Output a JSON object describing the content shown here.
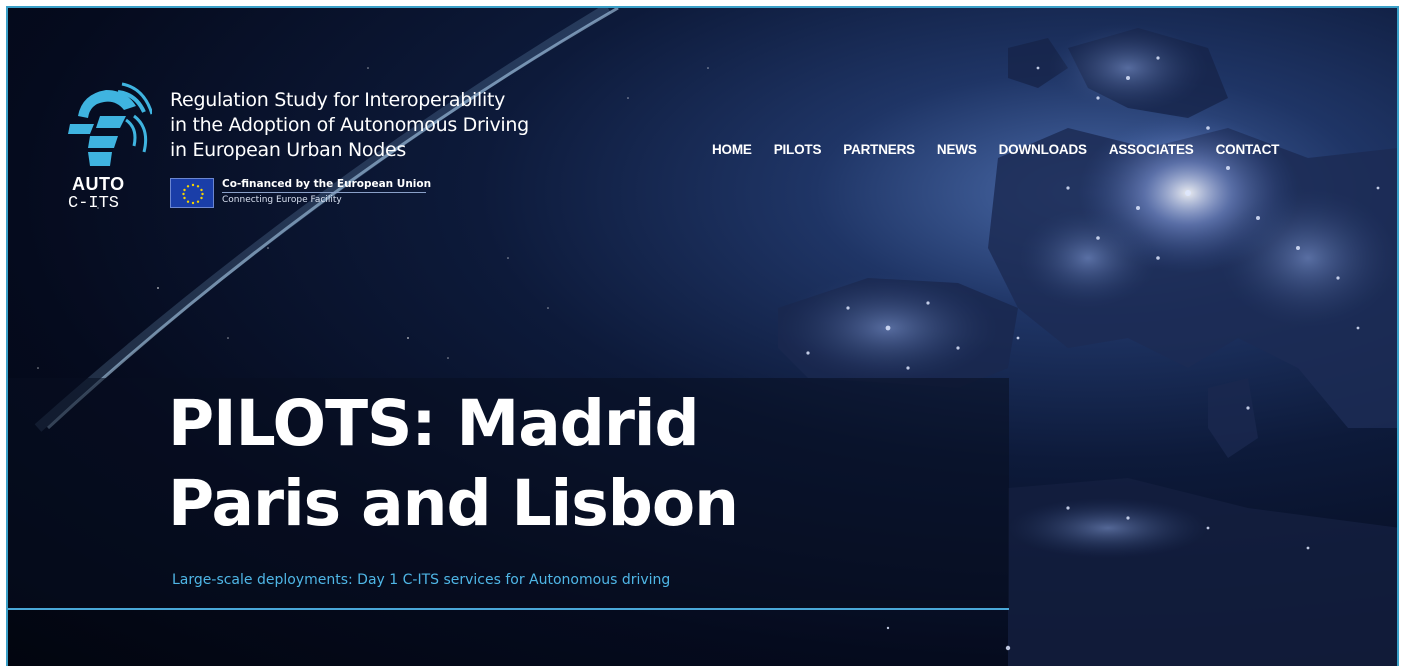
{
  "logo": {
    "name_line1": "AUTO",
    "name_line2": "C-ITS"
  },
  "tagline": {
    "line1": "Regulation Study for Interoperability",
    "line2": "in the Adoption of Autonomous Driving",
    "line3": "in European Urban Nodes"
  },
  "funding": {
    "line1": "Co-financed by the European Union",
    "line2": "Connecting Europe Facility"
  },
  "nav": {
    "items": [
      {
        "label": "HOME"
      },
      {
        "label": "PILOTS"
      },
      {
        "label": "PARTNERS"
      },
      {
        "label": "NEWS"
      },
      {
        "label": "DOWNLOADS"
      },
      {
        "label": "ASSOCIATES"
      },
      {
        "label": "CONTACT"
      }
    ]
  },
  "hero": {
    "title_line1": "PILOTS: Madrid",
    "title_line2": "Paris and Lisbon",
    "subtitle": "Large-scale deployments: Day 1 C-ITS services for Autonomous driving"
  },
  "colors": {
    "accent": "#4fb6e6",
    "frame_border": "#3aa0c8",
    "logo_blue": "#3fb4e0",
    "eu_blue": "#1a3ea8",
    "eu_star": "#f5d400"
  },
  "background": {
    "depiction": "night satellite view of Europe with city lights"
  }
}
